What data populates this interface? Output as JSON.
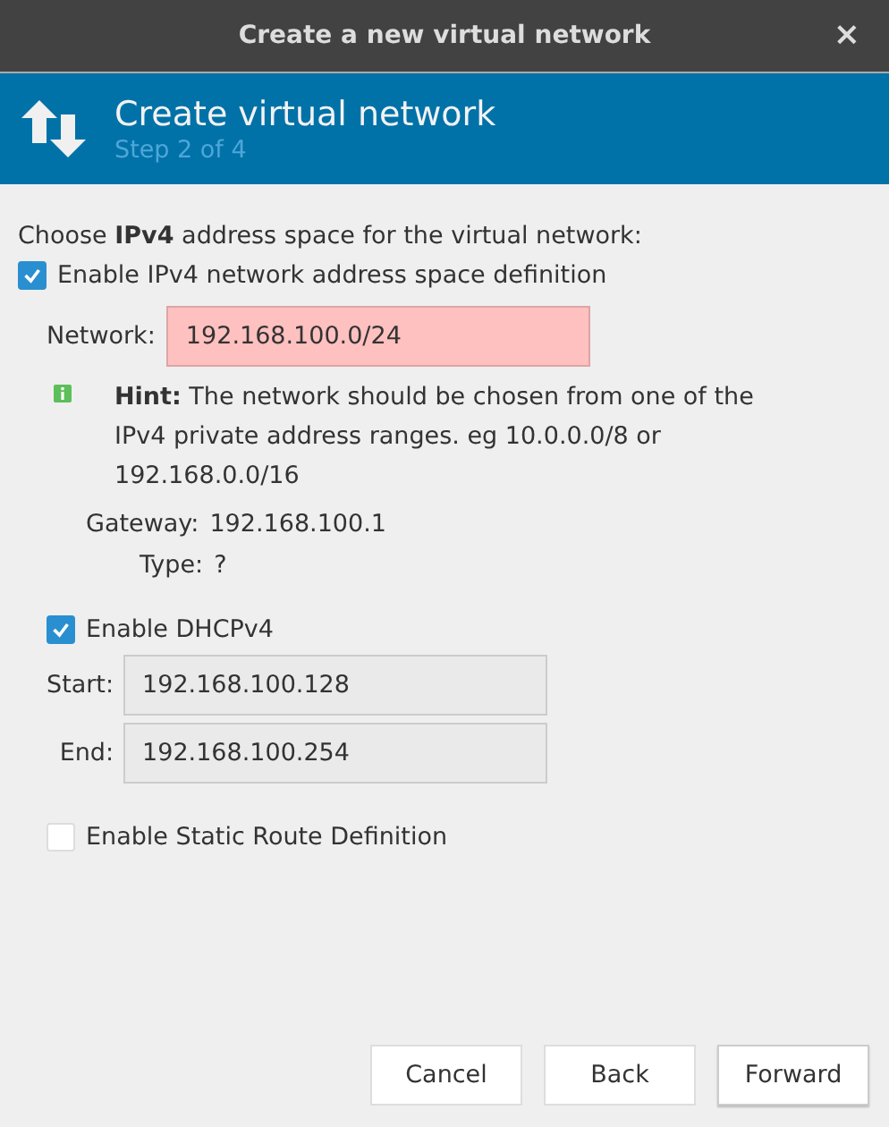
{
  "window": {
    "title": "Create a new virtual network",
    "close": "×"
  },
  "header": {
    "title": "Create virtual network",
    "step": "Step 2 of 4"
  },
  "intro": "Choose **IPv4** address space for the virtual network:",
  "enable_ipv4": {
    "label": "Enable IPv4 network address space definition",
    "checked": true
  },
  "network": {
    "label": "Network:",
    "value": "192.168.100.0/24",
    "invalid": true
  },
  "hint": "**Hint:** The network should be chosen from one of the IPv4 private address ranges. eg 10.0.0.0/8 or 192.168.0.0/16",
  "gateway": {
    "label": "Gateway:",
    "value": "192.168.100.1"
  },
  "type": {
    "label": "Type:",
    "value": "?"
  },
  "dhcp": {
    "label": "Enable DHCPv4",
    "checked": true
  },
  "range": [
    {
      "label": "Start:",
      "value": "192.168.100.128"
    },
    {
      "label": "End:",
      "value": "192.168.100.254"
    }
  ],
  "static_route": {
    "label": "Enable Static Route Definition",
    "checked": false
  },
  "buttons": [
    {
      "label": "Cancel"
    },
    {
      "label": "Back"
    },
    {
      "label": "Forward"
    }
  ]
}
